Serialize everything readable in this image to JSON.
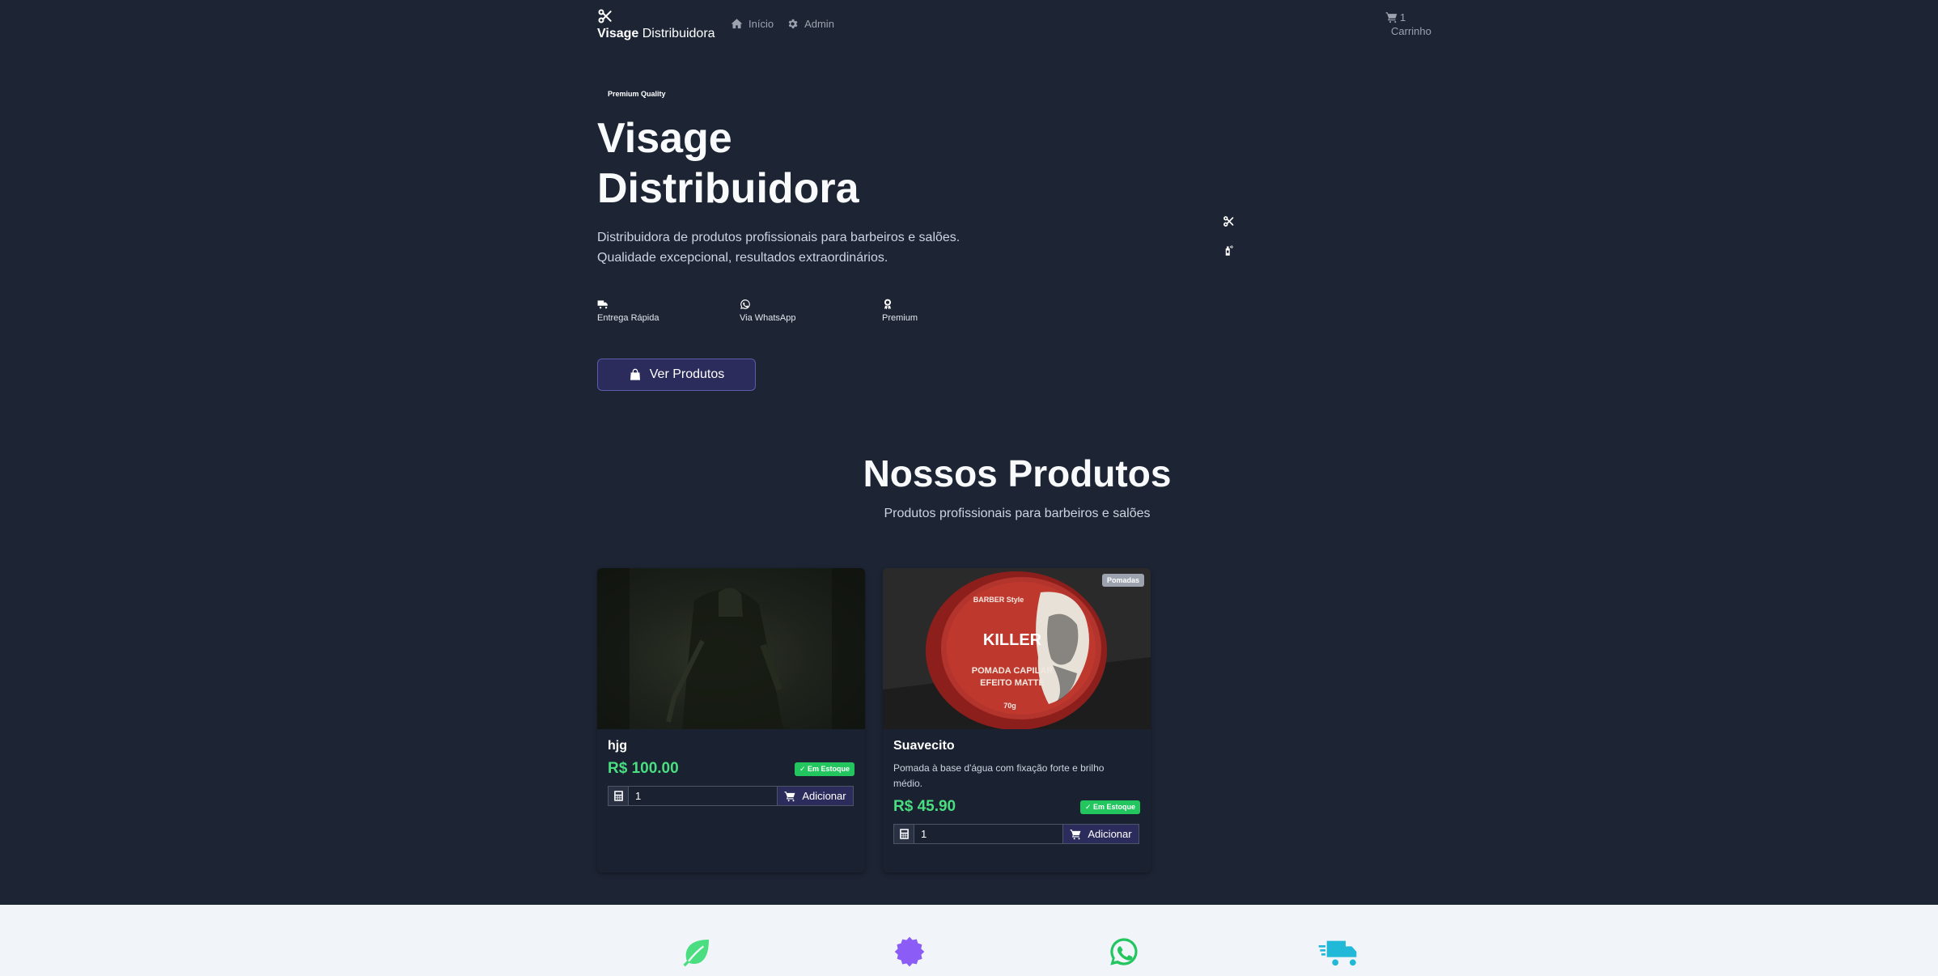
{
  "nav": {
    "brand_bold": "Visage",
    "brand_rest": " Distribuidora",
    "links": [
      {
        "label": "Início",
        "icon": "home-icon"
      },
      {
        "label": "Admin",
        "icon": "gear-icon"
      }
    ],
    "cart_count": "1",
    "cart_label": "Carrinho"
  },
  "hero": {
    "badge": "Premium Quality",
    "title": "Visage Distribuidora",
    "description_line1": "Distribuidora de produtos profissionais para barbeiros e salões.",
    "description_line2": "Qualidade excepcional, resultados extraordinários.",
    "features": [
      {
        "label": "Entrega Rápida",
        "icon": "truck-icon"
      },
      {
        "label": "Via WhatsApp",
        "icon": "whatsapp-icon"
      },
      {
        "label": "Premium",
        "icon": "award-icon"
      }
    ],
    "cta_label": "Ver Produtos"
  },
  "products_section": {
    "title": "Nossos Produtos",
    "subtitle": "Produtos profissionais para barbeiros e salões",
    "items": [
      {
        "name": "hjg",
        "description": "",
        "price": "R$ 100.00",
        "stock": "Em Estoque",
        "qty": "1",
        "add_label": "Adicionar",
        "category": ""
      },
      {
        "name": "Suavecito",
        "description": "Pomada à base d'água com fixação forte e brilho médio.",
        "price": "R$ 45.90",
        "stock": "Em Estoque",
        "qty": "1",
        "add_label": "Adicionar",
        "category": "Pomadas",
        "image_text": {
          "brand": "BARBER Style",
          "title": "KILLER",
          "line1": "POMADA CAPILAR",
          "line2": "EFEITO MATTE",
          "weight": "70g"
        }
      }
    ]
  },
  "colors": {
    "background": "#1d2434",
    "accent": "#2b2c5c",
    "price": "#4ade80",
    "stock_badge": "#22c55e",
    "footer_bg": "#f1f5f9",
    "leaf": "#4ade80",
    "seal": "#8b5cf6",
    "whatsapp": "#22c55e",
    "truck": "#22b8d8"
  }
}
